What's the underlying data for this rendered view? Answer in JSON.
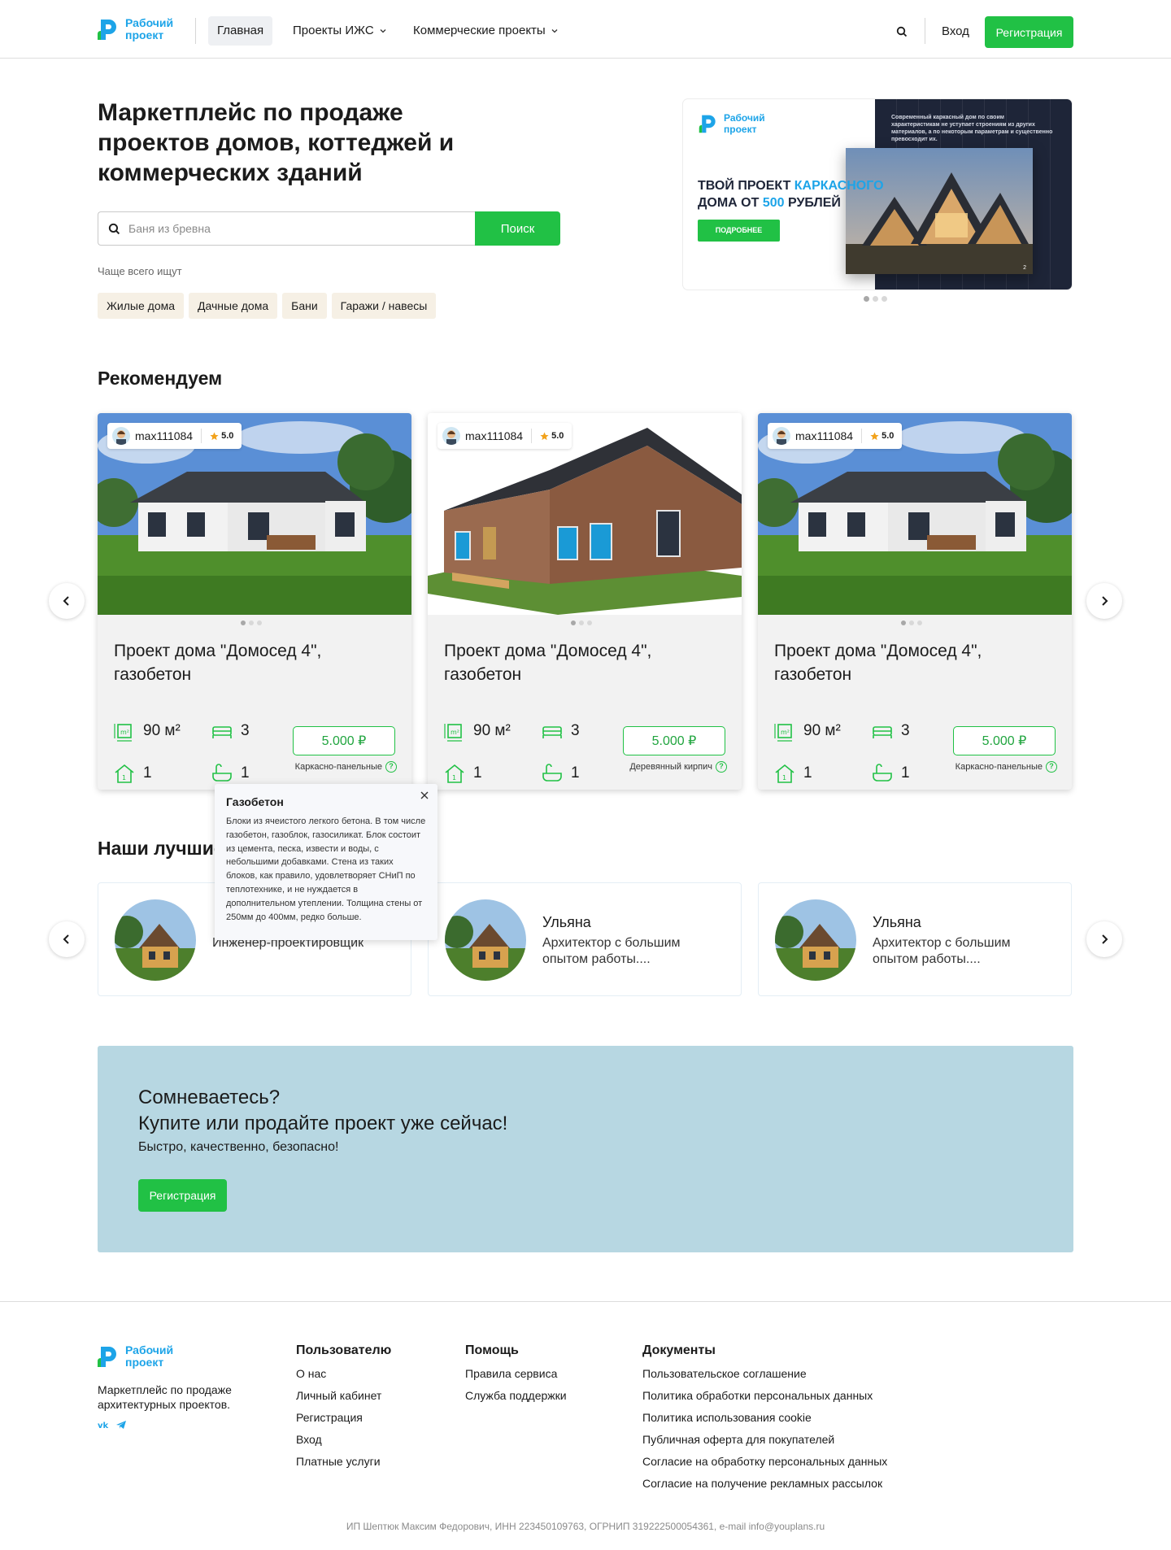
{
  "brand": {
    "name_line1": "Рабочий",
    "name_line2": "проект",
    "color": "#1da4e8",
    "accent": "#21c145"
  },
  "header": {
    "nav": [
      {
        "label": "Главная",
        "active": true
      },
      {
        "label": "Проекты ИЖС",
        "dropdown": true
      },
      {
        "label": "Коммерческие проекты",
        "dropdown": true
      }
    ],
    "search_icon": "search-icon",
    "login": "Вход",
    "register": "Регистрация"
  },
  "hero": {
    "title": "Маркетплейс по продаже проектов домов, коттеджей и коммерческих зданий",
    "search_placeholder": "Баня из бревна",
    "search_button": "Поиск",
    "popular_label": "Чаще всего ищут",
    "chips": [
      "Жилые дома",
      "Дачные дома",
      "Бани",
      "Гаражи / навесы"
    ]
  },
  "banner": {
    "small_text": "Современный каркасный дом по своим характеристикам не уступает строениям из других материалов, а по некоторым параметрам и существенно превосходит их.",
    "title_part1": "ТВОЙ ПРОЕКТ ",
    "title_accent1": "КАРКАСНОГО",
    "title_part2": " ДОМА ОТ ",
    "title_accent2": "500",
    "title_part3": " РУБЛЕЙ",
    "button": "ПОДРОБНЕЕ",
    "photo_counter": "2",
    "slides": 3,
    "active_slide": 1
  },
  "recommend": {
    "title": "Рекомендуем",
    "cards": [
      {
        "author": "max111084",
        "rating": "5.0",
        "title": "Проект дома \"Домосед 4\", газобетон",
        "area": "90 м²",
        "bedrooms": "3",
        "floors": "1",
        "bathrooms": "1",
        "price": "5.000 ₽",
        "material": "Каркасно-панельные",
        "image": "white-house"
      },
      {
        "author": "max111084",
        "rating": "5.0",
        "title": "Проект дома \"Домосед 4\", газобетон",
        "area": "90 м²",
        "bedrooms": "3",
        "floors": "1",
        "bathrooms": "1",
        "price": "5.000 ₽",
        "material": "Деревянный кирпич",
        "image": "brick-house"
      },
      {
        "author": "max111084",
        "rating": "5.0",
        "title": "Проект дома \"Домосед 4\", газобетон",
        "area": "90 м²",
        "bedrooms": "3",
        "floors": "1",
        "bathrooms": "1",
        "price": "5.000 ₽",
        "material": "Каркасно-панельные",
        "image": "white-house"
      }
    ]
  },
  "tooltip": {
    "title": "Газобетон",
    "body": "Блоки из ячеистого легкого бетона. В том числе газобетон, газоблок, газосиликат. Блок состоит из цемента, песка, извести и воды, с небольшими добавками. Стена из таких блоков, как правило, удовлетворяет СНиП по теплотехнике, и не нуждается в дополнительном утеплении. Толщина стены от 250мм до 400мм, редко больше."
  },
  "architects": {
    "title": "Наши лучшие",
    "items": [
      {
        "name": "",
        "role": "Инженер-проектировщик"
      },
      {
        "name": "Ульяна",
        "role": "Архитектор с большим опытом работы...."
      },
      {
        "name": "Ульяна",
        "role": "Архитектор с большим опытом работы...."
      }
    ]
  },
  "cta": {
    "line1": "Сомневаетесь?",
    "line2": "Купите или продайте проект уже сейчас!",
    "subtitle": "Быстро, качественно, безопасно!",
    "button": "Регистрация",
    "bg": "#b7d7e2"
  },
  "footer": {
    "tagline": "Маркетплейс по продаже архитектурных проектов.",
    "socials": [
      "vk-icon",
      "telegram-icon"
    ],
    "columns": [
      {
        "title": "Пользователю",
        "links": [
          "О нас",
          "Личный кабинет",
          "Регистрация",
          "Вход",
          "Платные услуги"
        ]
      },
      {
        "title": "Помощь",
        "links": [
          "Правила сервиса",
          "Служба поддержки"
        ]
      },
      {
        "title": "Документы",
        "links": [
          "Пользовательское соглашение",
          "Политика обработки персональных данных",
          "Политика использования cookie",
          "Публичная оферта для покупателей",
          "Согласие на обработку персональных данных",
          "Согласие на получение рекламных рассылок"
        ]
      }
    ],
    "copyright": "ИП Шептюк Максим Федорович, ИНН 223450109763, ОГРНИП 319222500054361, e-mail info@youplans.ru"
  }
}
